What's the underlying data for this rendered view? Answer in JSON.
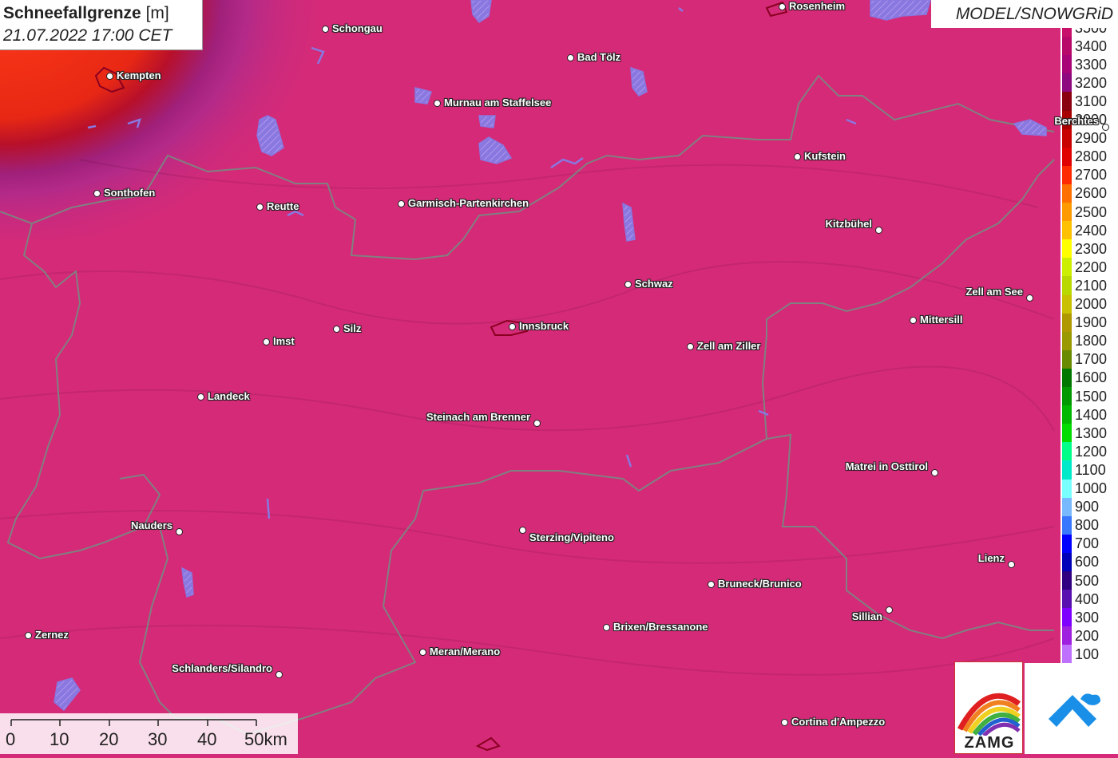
{
  "header": {
    "title_bold": "Schneefallgrenze",
    "title_unit": "[m]",
    "datetime": "21.07.2022 17:00 CET"
  },
  "model_label": "MODEL/SNOWGRiD",
  "legend": {
    "levels": [
      {
        "label": "3500",
        "color": "#c8106a"
      },
      {
        "label": "3400",
        "color": "#b8086a"
      },
      {
        "label": "3300",
        "color": "#a80478"
      },
      {
        "label": "3200",
        "color": "#8e0880"
      },
      {
        "label": "3100",
        "color": "#8a0010"
      },
      {
        "label": "3000",
        "color": "#a80000"
      },
      {
        "label": "2900",
        "color": "#c80000"
      },
      {
        "label": "2800",
        "color": "#e00000"
      },
      {
        "label": "2700",
        "color": "#ff2a00"
      },
      {
        "label": "2600",
        "color": "#ff7000"
      },
      {
        "label": "2500",
        "color": "#ff9a00"
      },
      {
        "label": "2400",
        "color": "#ffc000"
      },
      {
        "label": "2300",
        "color": "#ffff00"
      },
      {
        "label": "2200",
        "color": "#ccee00"
      },
      {
        "label": "2100",
        "color": "#b8d800"
      },
      {
        "label": "2000",
        "color": "#c8c000"
      },
      {
        "label": "1900",
        "color": "#b09800"
      },
      {
        "label": "1800",
        "color": "#9a9a00"
      },
      {
        "label": "1700",
        "color": "#6a8a00"
      },
      {
        "label": "1600",
        "color": "#007800"
      },
      {
        "label": "1500",
        "color": "#009a00"
      },
      {
        "label": "1400",
        "color": "#00b800"
      },
      {
        "label": "1300",
        "color": "#00dc00"
      },
      {
        "label": "1200",
        "color": "#00ff88"
      },
      {
        "label": "1100",
        "color": "#00eaca"
      },
      {
        "label": "1000",
        "color": "#7affff"
      },
      {
        "label": "900",
        "color": "#78b8ff"
      },
      {
        "label": "800",
        "color": "#3878ff"
      },
      {
        "label": "700",
        "color": "#0000ff"
      },
      {
        "label": "600",
        "color": "#0000b8"
      },
      {
        "label": "500",
        "color": "#300080"
      },
      {
        "label": "400",
        "color": "#5a10b0"
      },
      {
        "label": "300",
        "color": "#8000ff"
      },
      {
        "label": "200",
        "color": "#a020e0"
      },
      {
        "label": "100",
        "color": "#c070ff"
      }
    ]
  },
  "scale_bar": {
    "labels": [
      "0",
      "10",
      "20",
      "30",
      "40",
      "50km"
    ]
  },
  "cities": [
    {
      "name": "Rosenheim"
    },
    {
      "name": "Schongau"
    },
    {
      "name": "Bad Tölz"
    },
    {
      "name": "Kempten"
    },
    {
      "name": "Murnau am Staffelsee"
    },
    {
      "name": "Berchtes"
    },
    {
      "name": "Kufstein"
    },
    {
      "name": "Sonthofen"
    },
    {
      "name": "Reutte"
    },
    {
      "name": "Garmisch-Partenkirchen"
    },
    {
      "name": "Kitzbühel"
    },
    {
      "name": "Schwaz"
    },
    {
      "name": "Zell am See"
    },
    {
      "name": "Mittersill"
    },
    {
      "name": "Silz"
    },
    {
      "name": "Innsbruck"
    },
    {
      "name": "Imst"
    },
    {
      "name": "Zell am Ziller"
    },
    {
      "name": "Landeck"
    },
    {
      "name": "Steinach am Brenner"
    },
    {
      "name": "Matrei in Osttirol"
    },
    {
      "name": "Nauders"
    },
    {
      "name": "Sterzing/Vipiteno"
    },
    {
      "name": "Lienz"
    },
    {
      "name": "Bruneck/Brunico"
    },
    {
      "name": "Sillian"
    },
    {
      "name": "Zernez"
    },
    {
      "name": "Brixen/Bressanone"
    },
    {
      "name": "Meran/Merano"
    },
    {
      "name": "Schlanders/Silandro"
    },
    {
      "name": "Cortina d'Ampezzo"
    }
  ],
  "logos": {
    "zamg_text": "ZAMG"
  },
  "colors": {
    "map_background": "#d52a78",
    "lake_fill": "#8878e0",
    "border_line": "#808080"
  }
}
